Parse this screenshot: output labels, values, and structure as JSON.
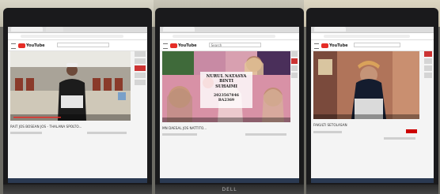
{
  "brand_color": "#e52d27",
  "laptop_brand": "DELL",
  "panels": [
    {
      "logo_text": "YouTube",
      "search_text": "",
      "video_title": "RAIT JOS BOSEAN JOS - THALANA SPOLTO..."
    },
    {
      "logo_text": "YouTube",
      "search_text": "Search",
      "video_title": "MN DAESAL JOS NATTITO...",
      "sticker_lines": [
        "NURUL NATASYA BINTI",
        "SUHAIMI",
        "2023567846",
        "BA2369"
      ]
    },
    {
      "logo_text": "YouTube",
      "search_text": "",
      "video_title": "FAKULTI SETOLASAN"
    }
  ]
}
